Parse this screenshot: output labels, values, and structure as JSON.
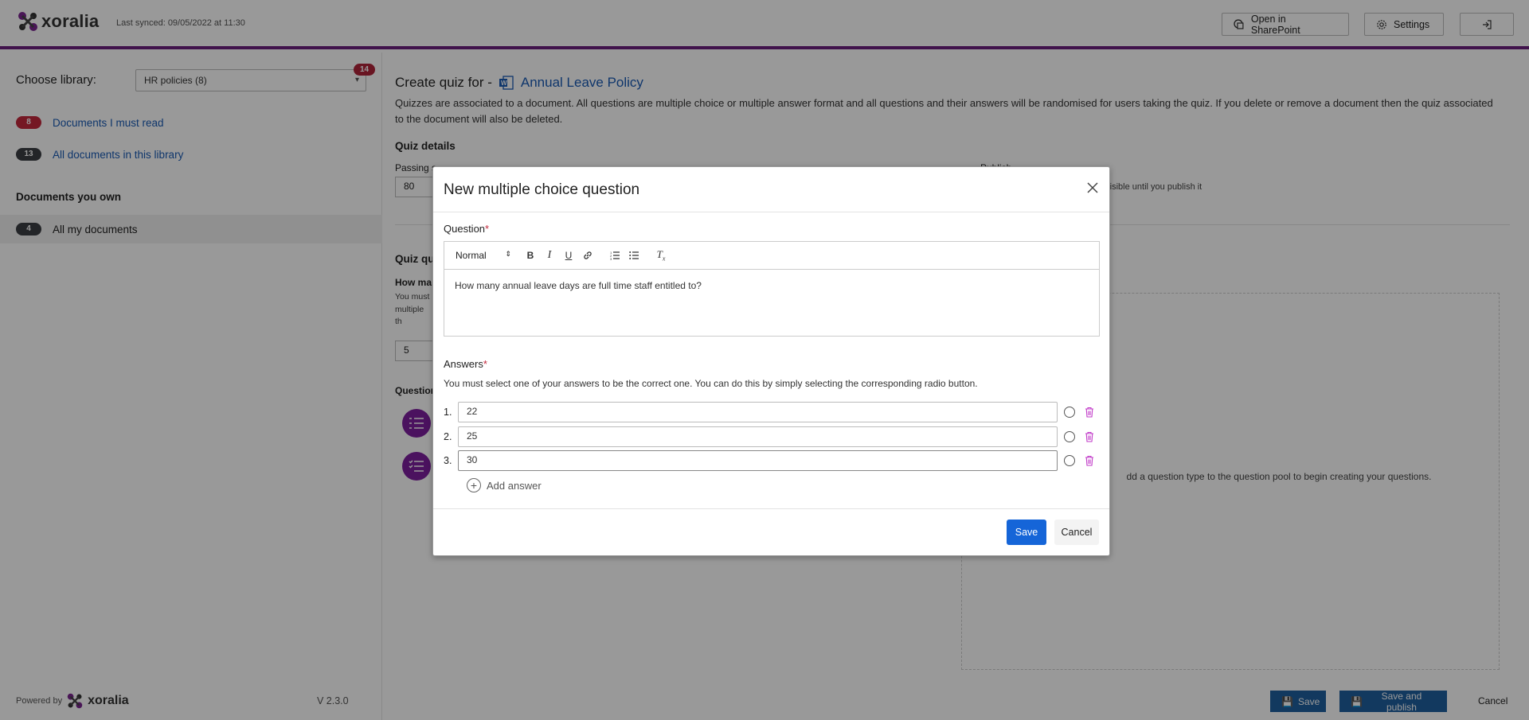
{
  "header": {
    "brand": "xoralia",
    "sync_text": "Last synced: 09/05/2022 at 11:30",
    "open_sharepoint": "Open in SharePoint",
    "settings": "Settings"
  },
  "sidebar": {
    "library_label": "Choose library:",
    "library_value": "HR policies (8)",
    "library_badge": "14",
    "items": [
      {
        "count": "8",
        "label": "Documents I must read"
      },
      {
        "count": "13",
        "label": "All documents in this library"
      }
    ],
    "owned_title": "Documents you own",
    "owned_item": {
      "count": "4",
      "label": "All my documents"
    },
    "powered_by": "Powered by",
    "powered_brand": "xoralia",
    "version": "V 2.3.0"
  },
  "main": {
    "title_prefix": "Create quiz for -",
    "document_name": "Annual Leave Policy",
    "description": "Quizzes are associated to a document. All questions are multiple choice or multiple answer format and all questions and their answers will be randomised for users taking the quiz. If you delete or remove a document then the quiz associated to the document will also be deleted.",
    "quiz_details": "Quiz details",
    "passing_label": "Passing s",
    "passing_value": "80",
    "published_label": "Publish",
    "published_note": "e visible until you publish it",
    "quiz_questions": "Quiz qu",
    "how_many": "How ma",
    "how_many_desc": "You must multiple th questions",
    "count_value": "5",
    "question_types": "Question",
    "pool_text": "dd a question type to the question pool to begin creating your questions.",
    "save": "Save",
    "save_publish": "Save and publish",
    "cancel": "Cancel"
  },
  "modal": {
    "title": "New multiple choice question",
    "question_label": "Question",
    "required_mark": "*",
    "format_value": "Normal",
    "question_text": "How many annual leave days are full time staff entitled to?",
    "answers_label": "Answers",
    "answers_help": "You must select one of your answers to be the correct one. You can do this by simply selecting the corresponding radio button.",
    "answers": [
      {
        "num": "1.",
        "value": "22"
      },
      {
        "num": "2.",
        "value": "25"
      },
      {
        "num": "3.",
        "value": "30"
      }
    ],
    "add_answer": "Add answer",
    "save": "Save",
    "cancel": "Cancel"
  },
  "colors": {
    "brand_purple": "#6b1f7e",
    "primary_blue": "#1565d8",
    "badge_red": "#c3283c",
    "trash_pink": "#c13ac8"
  }
}
